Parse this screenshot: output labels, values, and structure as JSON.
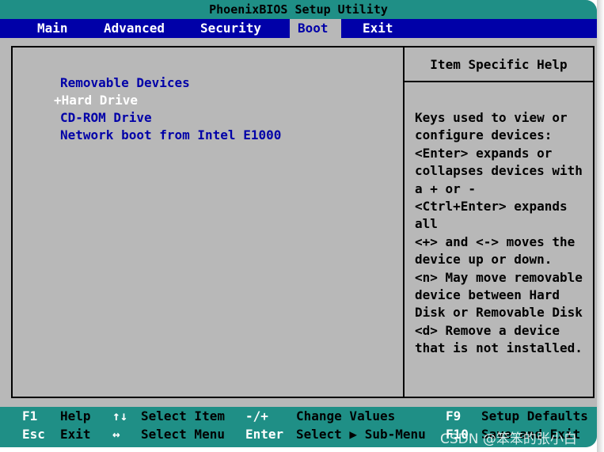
{
  "title": "PhoenixBIOS Setup Utility",
  "menu": [
    {
      "label": "Main",
      "active": false
    },
    {
      "label": "Advanced",
      "active": false
    },
    {
      "label": "Security",
      "active": false
    },
    {
      "label": "Boot",
      "active": true
    },
    {
      "label": "Exit",
      "active": false
    }
  ],
  "boot_items": [
    {
      "label": "Removable Devices",
      "selected": false
    },
    {
      "label": "+Hard Drive",
      "selected": true
    },
    {
      "label": "CD-ROM Drive",
      "selected": false
    },
    {
      "label": "Network boot from Intel E1000",
      "selected": false
    }
  ],
  "help": {
    "header": "Item Specific Help",
    "lines": [
      "Keys used to view or",
      "configure devices:",
      "<Enter> expands or",
      "collapses devices with",
      "a + or -",
      "<Ctrl+Enter> expands",
      "all",
      "<+> and <-> moves the",
      "device up or down.",
      "<n> May move removable",
      "device between Hard",
      "Disk or Removable Disk",
      "<d> Remove a device",
      "that is not installed."
    ]
  },
  "footer": {
    "row1": [
      {
        "key": "F1",
        "desc": "Help"
      },
      {
        "key": "↑↓",
        "desc": "Select Item"
      },
      {
        "key": "-/+",
        "desc": "Change Values"
      },
      {
        "key": "F9",
        "desc": "Setup Defaults"
      }
    ],
    "row2": [
      {
        "key": "Esc",
        "desc": "Exit"
      },
      {
        "key": "↔",
        "desc": "Select Menu"
      },
      {
        "key": "Enter",
        "desc": "Select ▶ Sub-Menu"
      },
      {
        "key": "F10",
        "desc": "Save and Exit"
      }
    ]
  },
  "watermark": "CSDN @笨笨的张小白",
  "colors": {
    "background": "#b8b8b8",
    "menu_bar": "#0000a8",
    "title_footer": "#1f8f86",
    "item_text": "#0000a8",
    "selected_text": "#ffffff"
  }
}
